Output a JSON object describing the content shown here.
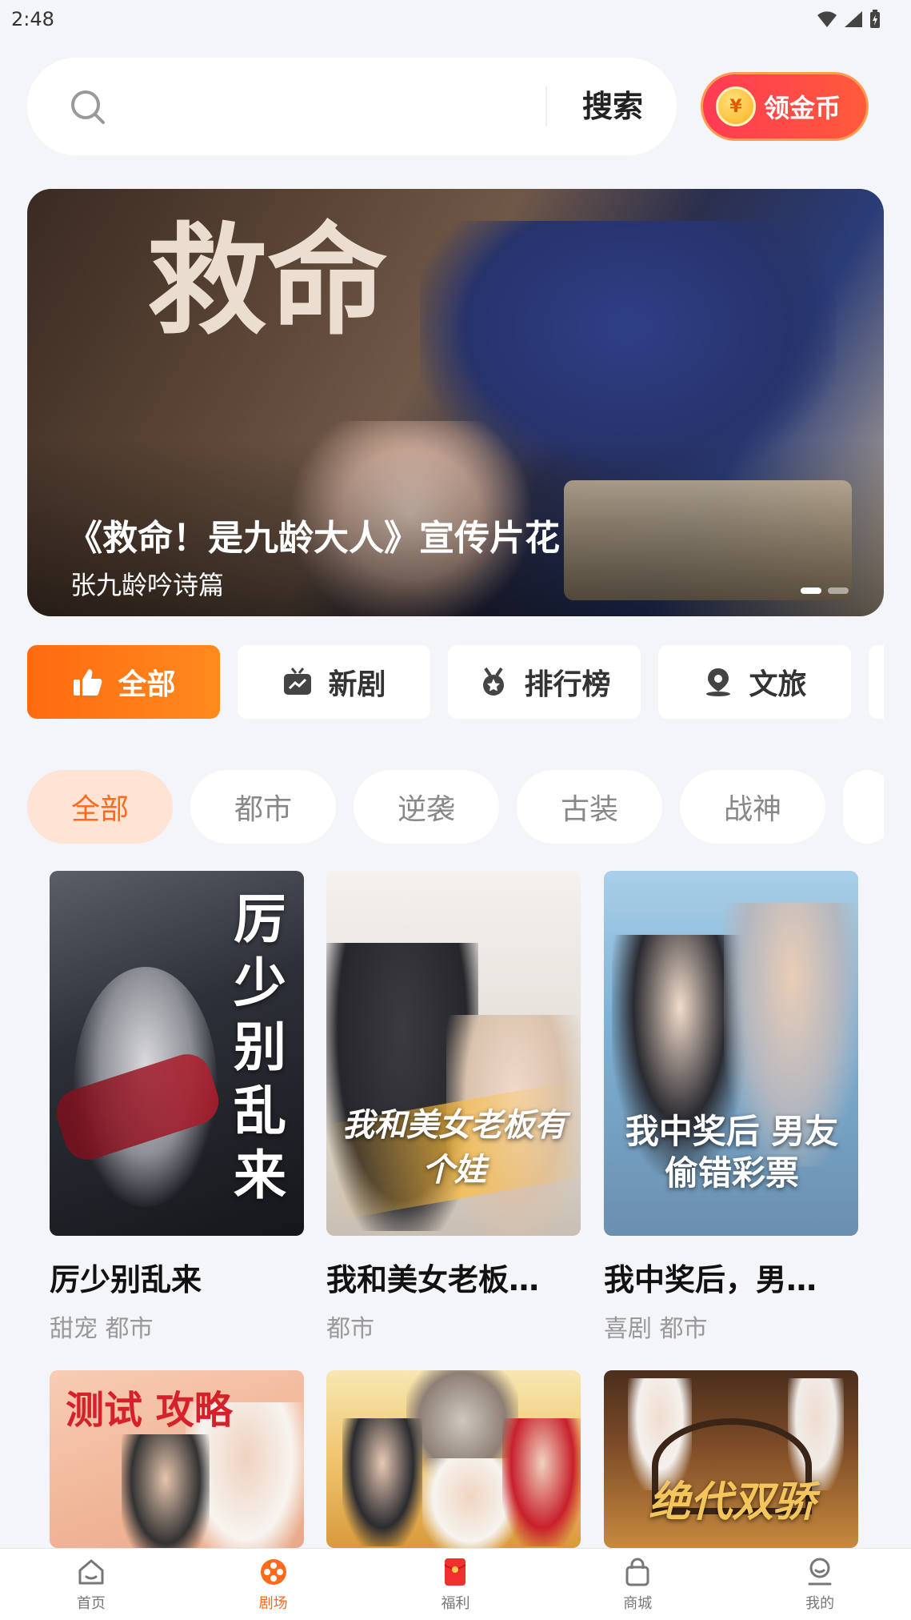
{
  "status_bar": {
    "time": "2:48"
  },
  "search": {
    "placeholder": "",
    "button_label": "搜索"
  },
  "coin_button": {
    "icon_glyph": "¥",
    "label": "领金币"
  },
  "banner": {
    "calligraphy": "救命",
    "title": "《救命！是九龄大人》宣传片花",
    "subtitle": "张九龄吟诗篇"
  },
  "categories": [
    {
      "label": "全部",
      "icon": "thumbs-up-icon",
      "active": true
    },
    {
      "label": "新剧",
      "icon": "tv-icon",
      "active": false
    },
    {
      "label": "排行榜",
      "icon": "medal-icon",
      "active": false
    },
    {
      "label": "文旅",
      "icon": "location-icon",
      "active": false
    }
  ],
  "genres": [
    {
      "label": "全部",
      "active": true
    },
    {
      "label": "都市",
      "active": false
    },
    {
      "label": "逆袭",
      "active": false
    },
    {
      "label": "古装",
      "active": false
    },
    {
      "label": "战神",
      "active": false
    }
  ],
  "dramas": [
    {
      "title": "厉少别乱来",
      "tags": "甜宠 都市",
      "poster_text": "厉少别乱来"
    },
    {
      "title": "我和美女老板…",
      "tags": "都市",
      "poster_text": "我和美女老板有个娃"
    },
    {
      "title": "我中奖后，男…",
      "tags": "喜剧 都市",
      "poster_text": "我中奖后 男友偷错彩票"
    },
    {
      "title": "",
      "tags": "",
      "poster_text": "测试 攻略"
    },
    {
      "title": "",
      "tags": "",
      "poster_text": ""
    },
    {
      "title": "",
      "tags": "",
      "poster_text": "绝代双骄"
    }
  ],
  "bottom_nav": [
    {
      "label": "首页",
      "icon": "home-icon",
      "active": false
    },
    {
      "label": "剧场",
      "icon": "film-reel-icon",
      "active": true
    },
    {
      "label": "福利",
      "icon": "red-envelope-icon",
      "active": false
    },
    {
      "label": "商城",
      "icon": "shopping-bag-icon",
      "active": false
    },
    {
      "label": "我的",
      "icon": "profile-icon",
      "active": false
    }
  ],
  "colors": {
    "accent": "#ff6a1a",
    "coin_red": "#ff3b54",
    "background": "#f4f5f9"
  }
}
